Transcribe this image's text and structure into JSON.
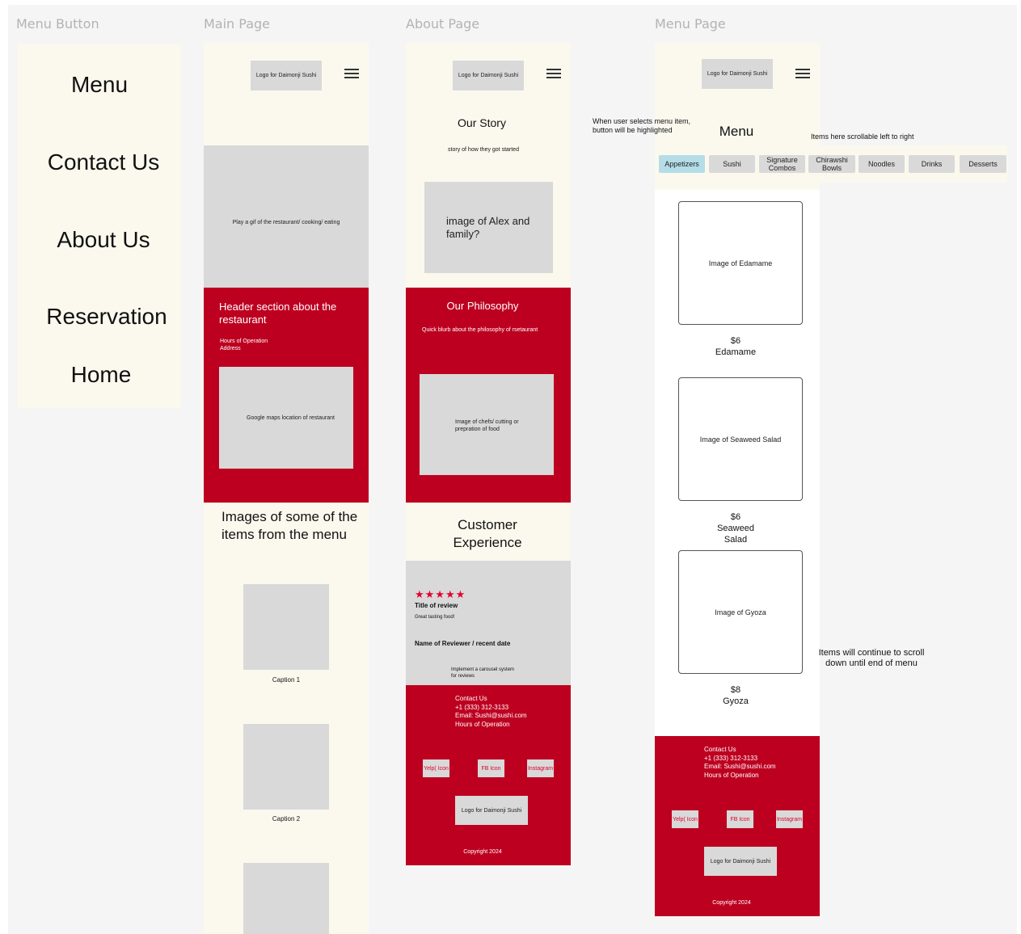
{
  "labels": {
    "menu_button": "Menu Button",
    "main_page": "Main Page",
    "about_page": "About Page",
    "menu_page": "Menu Page"
  },
  "menu_button": {
    "items": [
      "Menu",
      "Contact Us",
      "About Us",
      "Reservation",
      "Home"
    ]
  },
  "common": {
    "logo": "Logo for Daimonji Sushi",
    "hamburger_icon": "hamburger-menu-icon"
  },
  "main_page": {
    "gif_box": "Play a gif of the restaurant/ cooking/ eating",
    "header_title": "Header section about the restaurant",
    "hours": "Hours of Operation",
    "address": "Address",
    "map_box": "Google maps location of restaurant",
    "images_title": "Images of some of the items from the menu",
    "caption1": "Caption 1",
    "caption2": "Caption 2"
  },
  "about_page": {
    "story_title": "Our Story",
    "story_sub": "story of how they got started",
    "family_image": "image of Alex and family?",
    "philosophy_title": "Our Philosophy",
    "philosophy_blurb": "Quick blurb about the philosophy of rsetaurant",
    "chefs_image": "Image of chefs/ cutting or prepration of food",
    "experience_title": "Customer Experience",
    "review": {
      "stars": "★★★★★",
      "rating": 5,
      "title": "Title of review",
      "body": "Great tasting food!",
      "reviewer": "Name of Reviewer / recent date",
      "carousel_note": "Implement a carousel system for reviews"
    }
  },
  "footer": {
    "contact": "Contact Us",
    "phone": "+1 (333) 312-3133",
    "email": "Email: Sushi@sushi.com",
    "hours": "Hours of Operation",
    "yelp": "Yelp( Icon",
    "fb": "FB Icon",
    "instagram": "Instagram",
    "logo": "Logo for Daimonji Sushi",
    "copyright": "Copyright 2024"
  },
  "menu_page": {
    "title": "Menu",
    "note_highlight": "When user selects menu item, button will be highlighted",
    "note_scroll_lr": "Items here scrollable left to right",
    "note_scroll_down": "Items will continue to scroll down until end of menu",
    "categories": [
      "Appetizers",
      "Sushi",
      "Signature Combos",
      "Chirawshi Bowls",
      "Noodles",
      "Drinks",
      "Desserts"
    ],
    "active_category": "Appetizers",
    "items": [
      {
        "image": "Image of Edamame",
        "price": "$6",
        "name": "Edamame"
      },
      {
        "image": "Image of Seaweed Salad",
        "price": "$6",
        "name": "Seaweed Salad"
      },
      {
        "image": "Image of Gyoza",
        "price": "$8",
        "name": "Gyoza"
      }
    ]
  },
  "colors": {
    "cream": "#fbf9ee",
    "red": "#bd0020",
    "gray": "#d9d9d9",
    "highlight": "#b4dde8"
  }
}
